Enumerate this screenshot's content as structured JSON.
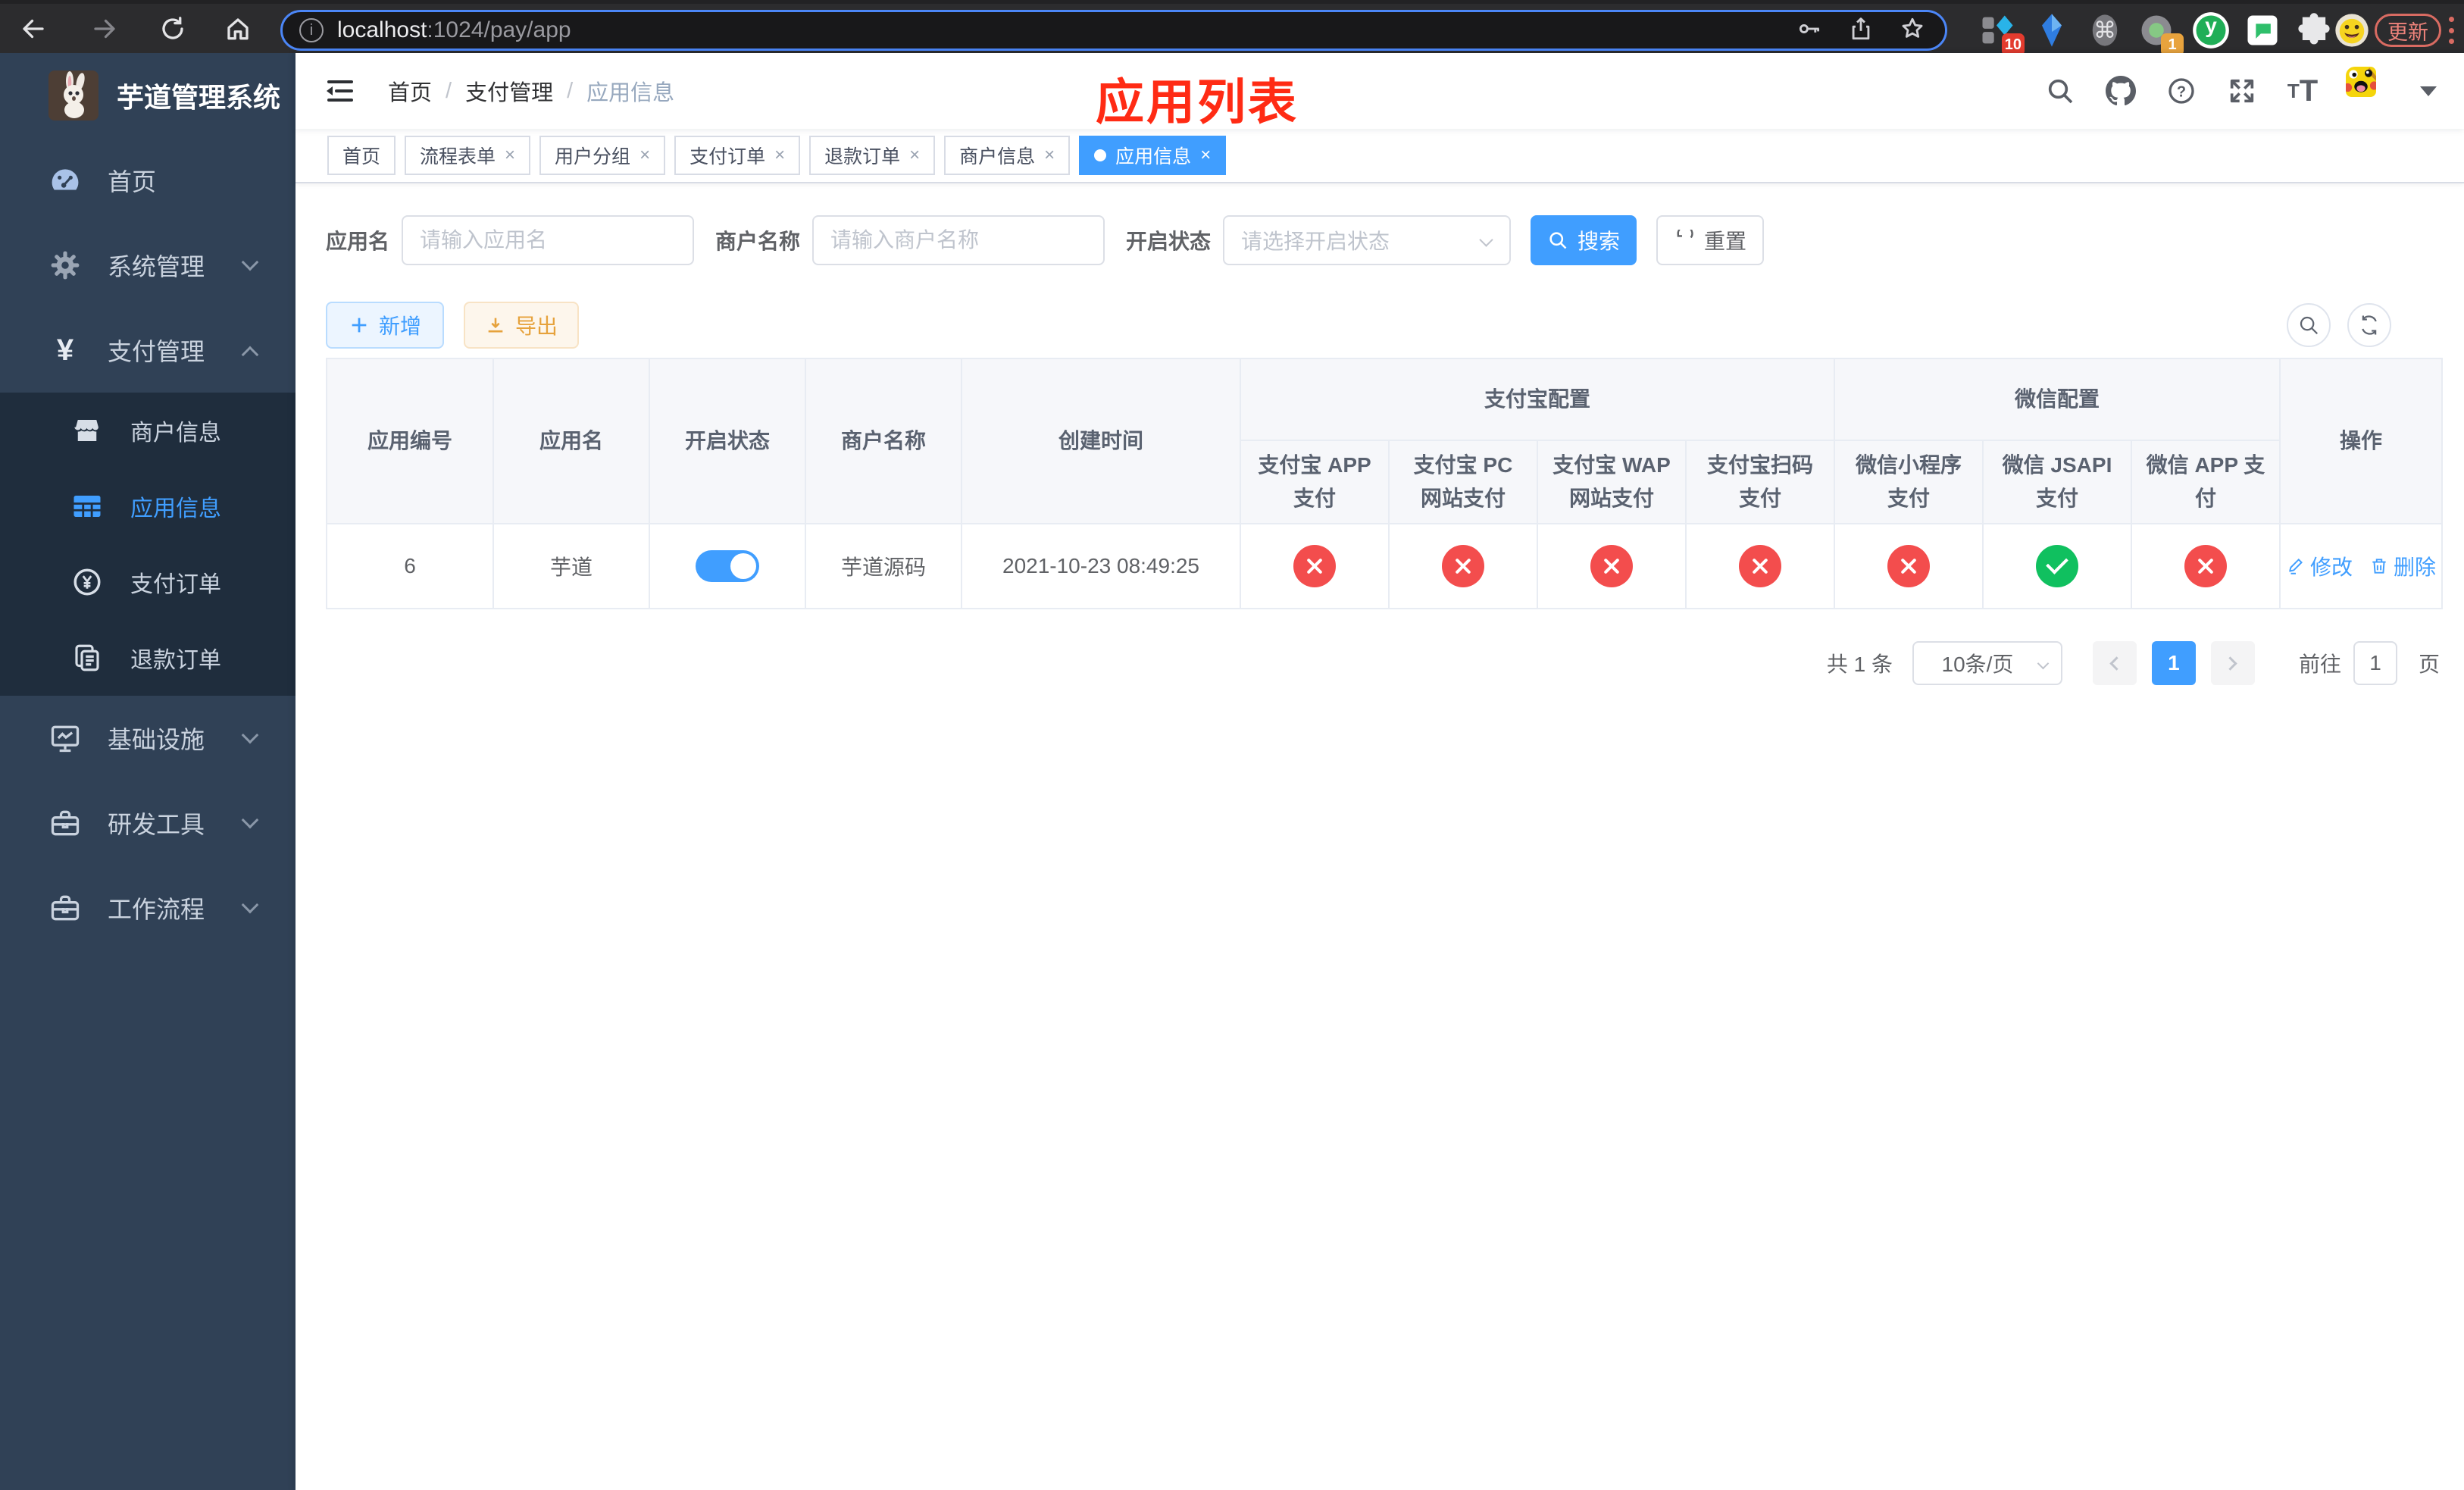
{
  "colors": {
    "accent": "#409eff",
    "success": "#10c05f",
    "danger": "#f34d4d",
    "warning": "#e6a23c",
    "sidebar_bg": "#304156",
    "submenu_bg": "#1f2d3d"
  },
  "browser": {
    "url_host": "localhost",
    "url_path": ":1024/pay/app",
    "update_label": "更新",
    "ext_badge_blue": "10",
    "ext_badge_green": "1"
  },
  "icons": {
    "cmd_glyph": "⌘",
    "yen_glyph": "¥",
    "size_small": "T",
    "size_large": "T",
    "question_glyph": "?",
    "ext_y_glyph": "y"
  },
  "sidebar": {
    "logo_title": "芋道管理系统",
    "items": [
      {
        "label": "首页"
      },
      {
        "label": "系统管理"
      },
      {
        "label": "支付管理"
      },
      {
        "label": "基础设施"
      },
      {
        "label": "研发工具"
      },
      {
        "label": "工作流程"
      }
    ],
    "submenu": [
      {
        "label": "商户信息"
      },
      {
        "label": "应用信息"
      },
      {
        "label": "支付订单"
      },
      {
        "label": "退款订单"
      }
    ]
  },
  "navbar": {
    "breadcrumb": [
      "首页",
      "支付管理",
      "应用信息"
    ]
  },
  "annotation": {
    "title": "应用列表"
  },
  "tabs": [
    {
      "label": "首页"
    },
    {
      "label": "流程表单"
    },
    {
      "label": "用户分组"
    },
    {
      "label": "支付订单"
    },
    {
      "label": "退款订单"
    },
    {
      "label": "商户信息"
    },
    {
      "label": "应用信息"
    }
  ],
  "filters": {
    "app_name": {
      "label": "应用名",
      "placeholder": "请输入应用名",
      "value": ""
    },
    "merchant_name": {
      "label": "商户名称",
      "placeholder": "请输入商户名称",
      "value": ""
    },
    "status": {
      "label": "开启状态",
      "placeholder": "请选择开启状态",
      "value": ""
    },
    "search_label": "搜索",
    "reset_label": "重置"
  },
  "toolbar": {
    "add_label": "新增",
    "export_label": "导出"
  },
  "table": {
    "columns": {
      "id": "应用编号",
      "name": "应用名",
      "status": "开启状态",
      "merchant": "商户名称",
      "created": "创建时间",
      "alipay_group": "支付宝配置",
      "alipay_cols": [
        "支付宝 APP 支付",
        "支付宝 PC 网站支付",
        "支付宝 WAP 网站支付",
        "支付宝扫码支付"
      ],
      "wechat_group": "微信配置",
      "wechat_cols": [
        "微信小程序支付",
        "微信 JSAPI 支付",
        "微信 APP 支付"
      ],
      "actions": "操作"
    },
    "rows": [
      {
        "id": "6",
        "name": "芋道",
        "enabled": true,
        "merchant": "芋道源码",
        "created": "2021-10-23 08:49:25",
        "configs": [
          "fail",
          "fail",
          "fail",
          "fail",
          "fail",
          "success",
          "fail"
        ],
        "edit_label": "修改",
        "delete_label": "删除"
      }
    ]
  },
  "pagination": {
    "total": "共 1 条",
    "page_size": "10条/页",
    "current_page": "1",
    "goto_label": "前往",
    "goto_value": "1",
    "page_unit": "页"
  }
}
